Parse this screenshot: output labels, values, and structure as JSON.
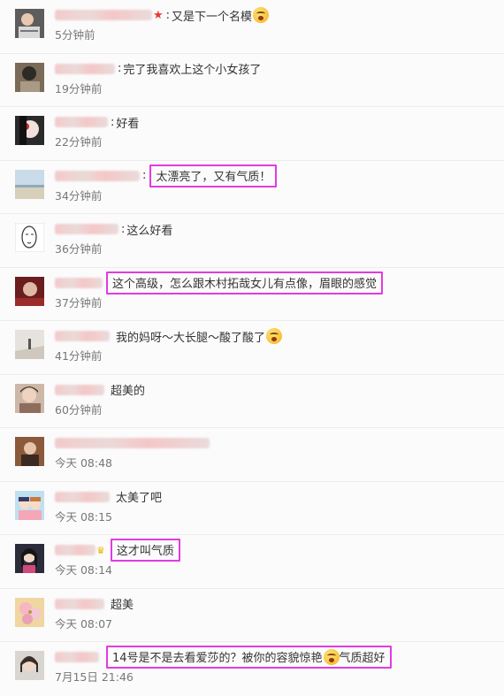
{
  "comments": [
    {
      "text": "又是下一个名模",
      "time": "5分钟前",
      "highlight": false,
      "badge": "star",
      "emoji": true
    },
    {
      "text": "完了我喜欢上这个小女孩了",
      "time": "19分钟前",
      "highlight": false
    },
    {
      "text": "好看",
      "time": "22分钟前",
      "highlight": false
    },
    {
      "text": "太漂亮了，又有气质！",
      "time": "34分钟前",
      "highlight": true
    },
    {
      "text": "这么好看",
      "time": "36分钟前",
      "highlight": false
    },
    {
      "text": "这个高级，怎么跟木村拓哉女儿有点像，眉眼的感觉",
      "time": "37分钟前",
      "highlight": true
    },
    {
      "text": "我的妈呀～大长腿～酸了酸了",
      "time": "41分钟前",
      "highlight": false,
      "emoji": true
    },
    {
      "text": "超美的",
      "time": "60分钟前",
      "highlight": false
    },
    {
      "text": "",
      "time": "今天 08:48",
      "highlight": false
    },
    {
      "text": "太美了吧",
      "time": "今天 08:15",
      "highlight": false
    },
    {
      "text": "这才叫气质",
      "time": "今天 08:14",
      "highlight": true,
      "badge": "crown"
    },
    {
      "text": "超美",
      "time": "今天 08:07",
      "highlight": false
    },
    {
      "text_before": "14号是不是去看爱莎的？被你的容貌惊艳",
      "text_after": "气质超好",
      "time": "7月15日 21:46",
      "highlight": true
    }
  ]
}
